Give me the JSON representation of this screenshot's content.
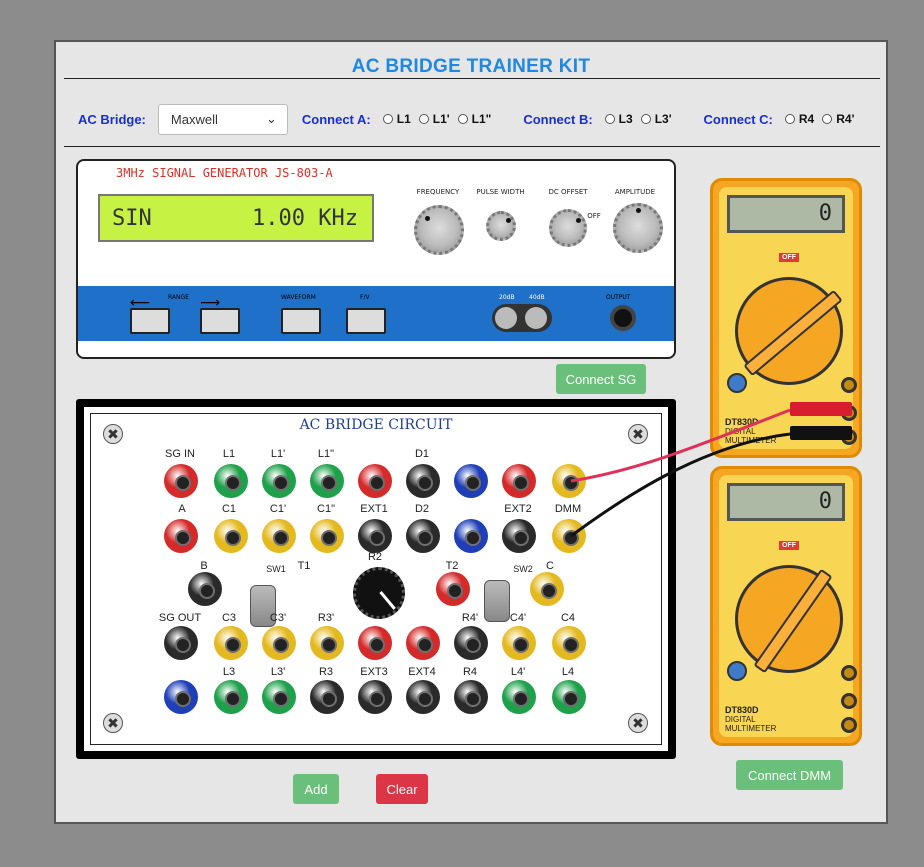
{
  "header": {
    "title": "AC BRIDGE TRAINER KIT"
  },
  "controls": {
    "bridge_label": "AC Bridge:",
    "bridge_value": "Maxwell",
    "connect_a": {
      "label": "Connect A:",
      "options": [
        "L1",
        "L1'",
        "L1\""
      ]
    },
    "connect_b": {
      "label": "Connect B:",
      "options": [
        "L3",
        "L3'"
      ]
    },
    "connect_c": {
      "label": "Connect C:",
      "options": [
        "R4",
        "R4'"
      ]
    }
  },
  "signal_generator": {
    "title": "3MHz SIGNAL GENERATOR JS-803-A",
    "display": {
      "waveform": "SIN",
      "frequency": "1.00 KHz"
    },
    "knobs": {
      "frequency": "FREQUENCY",
      "pulse_width": "PULSE WIDTH",
      "dc_offset": "DC OFFSET",
      "off": "OFF",
      "amplitude": "AMPLITUDE"
    },
    "buttons": {
      "range": "RANGE",
      "waveform": "WAVEFORM",
      "fv": "F/V",
      "db20": "20dB",
      "db40": "40dB",
      "output": "OUTPUT"
    },
    "connect_label": "Connect SG"
  },
  "bridge_circuit": {
    "title": "AC BRIDGE CIRCUIT",
    "labels": {
      "sg_in": "SG IN",
      "l1": "L1",
      "l1p": "L1'",
      "l1pp": "L1\"",
      "d1": "D1",
      "a": "A",
      "c1": "C1",
      "c1p": "C1'",
      "c1pp": "C1\"",
      "ext1": "EXT1",
      "d2": "D2",
      "ext2": "EXT2",
      "dmm": "DMM",
      "b": "B",
      "sw1": "SW1",
      "t1": "T1",
      "r2": "R2",
      "t2": "T2",
      "sw2": "SW2",
      "c": "C",
      "sg_out": "SG OUT",
      "c3": "C3",
      "c3p": "C3'",
      "r3p": "R3'",
      "r4p": "R4'",
      "c4p": "C4'",
      "c4": "C4",
      "l3": "L3",
      "l3p": "L3'",
      "r3": "R3",
      "ext3": "EXT3",
      "ext4": "EXT4",
      "r4": "R4",
      "l4p": "L4'",
      "l4": "L4"
    }
  },
  "buttons": {
    "add": "Add",
    "clear": "Clear"
  },
  "multimeter_top": {
    "reading": "0",
    "model": "DT830D",
    "line1": "DIGITAL",
    "line2": "MULTIMETER",
    "off": "OFF"
  },
  "multimeter_bottom": {
    "reading": "0",
    "model": "DT830D",
    "line1": "DIGITAL",
    "line2": "MULTIMETER",
    "off": "OFF",
    "connect_label": "Connect DMM"
  },
  "colors": {
    "title_blue": "#1e88e5",
    "label_blue": "#1a2dd6",
    "connect_green": "#6abf7b",
    "clear_red": "#dc3545"
  }
}
